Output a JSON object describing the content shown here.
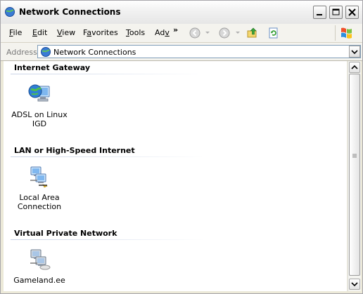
{
  "window": {
    "title": "Network Connections"
  },
  "titlebar_buttons": [
    "minimize",
    "maximize",
    "close"
  ],
  "menubar": {
    "items": [
      {
        "key": "F",
        "rest": "ile"
      },
      {
        "key": "E",
        "rest": "dit"
      },
      {
        "key": "V",
        "rest": "iew"
      },
      {
        "prefix": "F",
        "key": "a",
        "rest": "vorites"
      },
      {
        "key": "T",
        "rest": "ools"
      },
      {
        "prefix": "Ad",
        "key": "v",
        "rest": ""
      }
    ],
    "overflow": "»"
  },
  "toolbar": {
    "icons": [
      "back-icon",
      "forward-icon",
      "up-folder-icon",
      "refresh-folder-icon"
    ]
  },
  "address": {
    "label": "Address",
    "value": "Network Connections"
  },
  "groups": [
    {
      "title": "Internet Gateway",
      "items": [
        {
          "label_line1": "ADSL on Linux",
          "label_line2": "IGD"
        }
      ]
    },
    {
      "title": "LAN or High-Speed Internet",
      "items": [
        {
          "label_line1": "Local Area",
          "label_line2": "Connection"
        }
      ]
    },
    {
      "title": "Virtual Private Network",
      "items": [
        {
          "label_line1": "Gameland.ee",
          "label_line2": ""
        }
      ]
    }
  ]
}
